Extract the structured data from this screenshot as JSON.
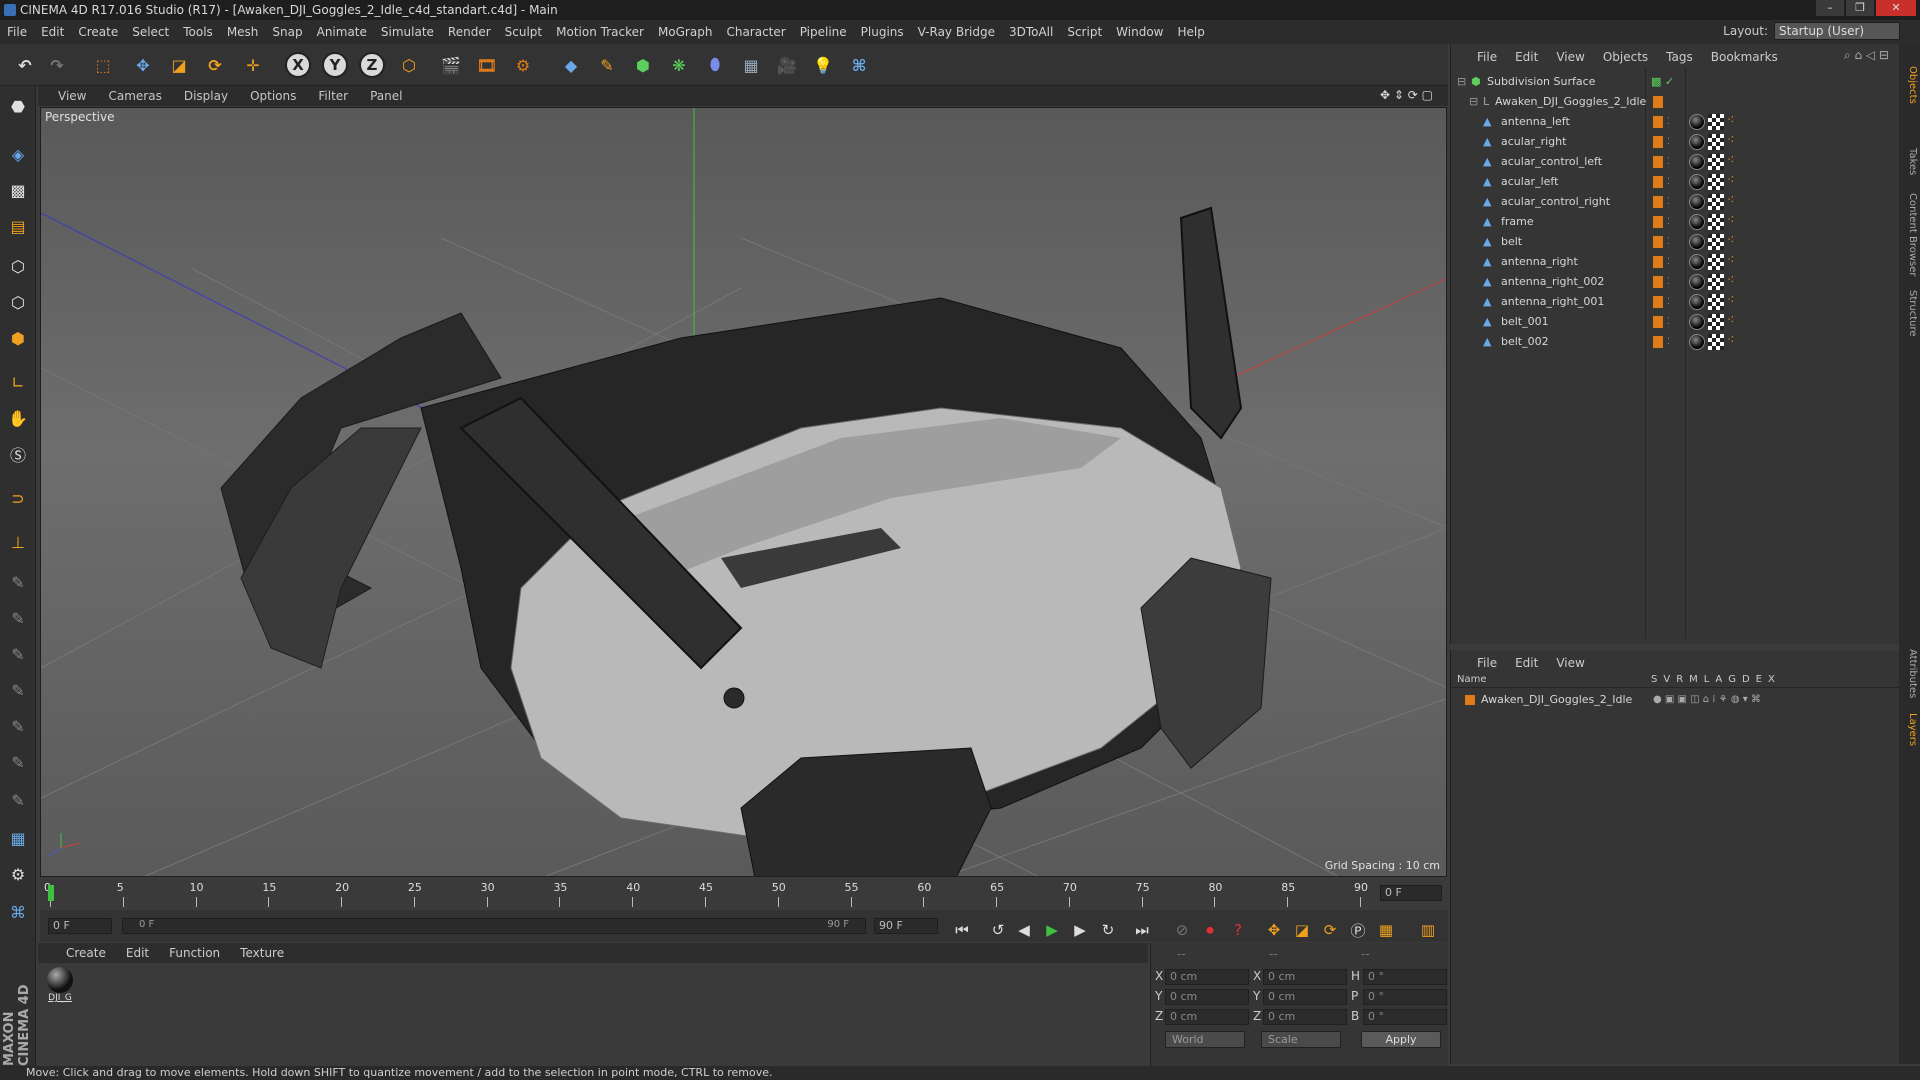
{
  "window": {
    "title": "CINEMA 4D R17.016 Studio (R17) - [Awaken_DJI_Goggles_2_Idle_c4d_standart.c4d] - Main"
  },
  "menubar": [
    "File",
    "Edit",
    "Create",
    "Select",
    "Tools",
    "Mesh",
    "Snap",
    "Animate",
    "Simulate",
    "Render",
    "Sculpt",
    "Motion Tracker",
    "MoGraph",
    "Character",
    "Pipeline",
    "Plugins",
    "V-Ray Bridge",
    "3DToAll",
    "Script",
    "Window",
    "Help"
  ],
  "layout": {
    "label": "Layout:",
    "value": "Startup (User)"
  },
  "toolbar": {
    "x": "X",
    "y": "Y",
    "z": "Z"
  },
  "viewport": {
    "menu": [
      "View",
      "Cameras",
      "Display",
      "Options",
      "Filter",
      "Panel"
    ],
    "label": "Perspective",
    "grid_spacing": "Grid Spacing : 10 cm"
  },
  "timeline": {
    "ticks": [
      "0",
      "5",
      "10",
      "15",
      "20",
      "25",
      "30",
      "35",
      "40",
      "45",
      "50",
      "55",
      "60",
      "65",
      "70",
      "75",
      "80",
      "85",
      "90"
    ],
    "current_frame": "0 F",
    "start": "0 F",
    "slider_start": "0 F",
    "slider_end": "90 F",
    "end": "90 F"
  },
  "material_manager": {
    "menu": [
      "Create",
      "Edit",
      "Function",
      "Texture"
    ],
    "materials": [
      {
        "name": "DJI_G"
      }
    ]
  },
  "coordinates": {
    "headers": [
      "--",
      "--",
      "--"
    ],
    "rows": [
      {
        "pos_label": "X",
        "pos": "0 cm",
        "size_label": "X",
        "size": "0 cm",
        "rot_label": "H",
        "rot": "0 °"
      },
      {
        "pos_label": "Y",
        "pos": "0 cm",
        "size_label": "Y",
        "size": "0 cm",
        "rot_label": "P",
        "rot": "0 °"
      },
      {
        "pos_label": "Z",
        "pos": "0 cm",
        "size_label": "Z",
        "size": "0 cm",
        "rot_label": "B",
        "rot": "0 °"
      }
    ],
    "space": "World",
    "mode": "Scale",
    "apply": "Apply"
  },
  "object_manager": {
    "menu": [
      "File",
      "Edit",
      "View",
      "Objects",
      "Tags",
      "Bookmarks"
    ],
    "root": "Subdivision Surface",
    "group": "Awaken_DJI_Goggles_2_Idle",
    "objects": [
      "antenna_left",
      "acular_right",
      "acular_control_left",
      "acular_left",
      "acular_control_right",
      "frame",
      "belt",
      "antenna_right",
      "antenna_right_002",
      "antenna_right_001",
      "belt_001",
      "belt_002"
    ]
  },
  "layer_manager": {
    "menu": [
      "File",
      "Edit",
      "View"
    ],
    "header_name": "Name",
    "columns": [
      "S",
      "V",
      "R",
      "M",
      "L",
      "A",
      "G",
      "D",
      "E",
      "X"
    ],
    "layers": [
      "Awaken_DJI_Goggles_2_Idle"
    ]
  },
  "side_tabs": [
    "Objects",
    "Takes",
    "Content Browser",
    "Structure",
    "Attributes",
    "Layers"
  ],
  "brand": "MAXON CINEMA 4D",
  "status": "Move: Click and drag to move elements. Hold down SHIFT to quantize movement / add to the selection in point mode, CTRL to remove.",
  "colors": {
    "accent": "#e07b1a",
    "green": "#40c040"
  }
}
